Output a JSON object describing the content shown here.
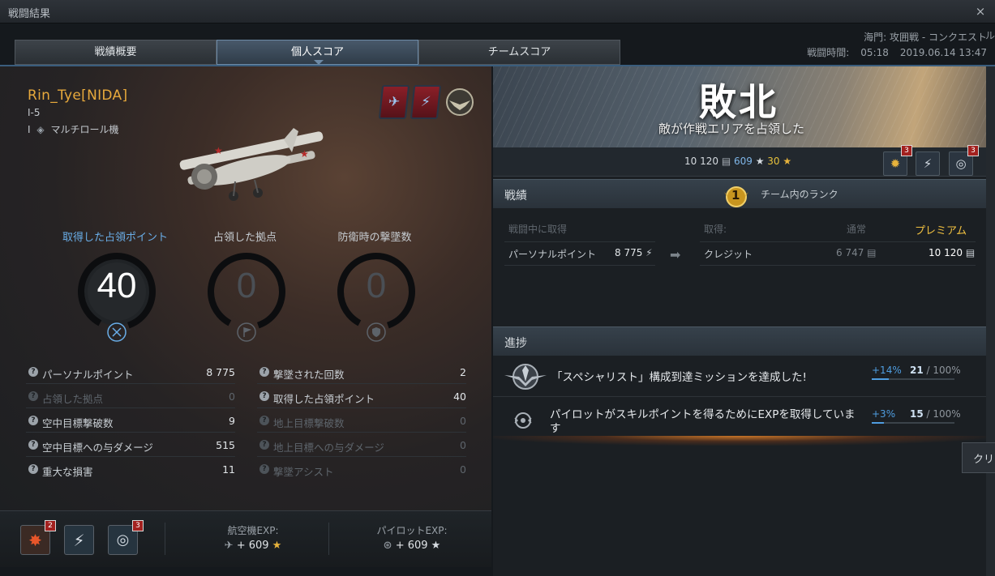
{
  "window": {
    "title": "戦闘結果",
    "close": "×"
  },
  "tabs": [
    {
      "label": "戦績概要"
    },
    {
      "label": "個人スコア"
    },
    {
      "label": "チームスコア"
    }
  ],
  "header": {
    "map_mode": "海門: 攻囲戦 - コンクエスト",
    "duration_label": "戦闘時間:",
    "duration": "05:18",
    "datetime": "2019.06.14 13:47",
    "edge_text": "ル"
  },
  "player": {
    "name": "Rin_Tye[NIDA]",
    "aircraft": "I-5",
    "tier": "I",
    "role": "マルチロール機"
  },
  "key_stats": [
    {
      "label": "取得した占領ポイント",
      "value": "40",
      "icon": "crossed-swords-icon",
      "active": true
    },
    {
      "label": "占領した拠点",
      "value": "0",
      "icon": "flag-icon",
      "active": false
    },
    {
      "label": "防衛時の撃墜数",
      "value": "0",
      "icon": "shield-icon",
      "active": false
    }
  ],
  "stats_left": [
    {
      "label": "パーソナルポイント",
      "value": "8 775",
      "dim": false
    },
    {
      "label": "占領した拠点",
      "value": "0",
      "dim": true
    },
    {
      "label": "空中目標撃破数",
      "value": "9",
      "dim": false
    },
    {
      "label": "空中目標への与ダメージ",
      "value": "515",
      "dim": false
    },
    {
      "label": "重大な損害",
      "value": "11",
      "dim": false
    }
  ],
  "stats_right": [
    {
      "label": "撃墜された回数",
      "value": "2",
      "dim": false
    },
    {
      "label": "取得した占領ポイント",
      "value": "40",
      "dim": false
    },
    {
      "label": "地上目標撃破数",
      "value": "0",
      "dim": true
    },
    {
      "label": "地上目標への与ダメージ",
      "value": "0",
      "dim": true
    },
    {
      "label": "撃墜アシスト",
      "value": "0",
      "dim": true
    }
  ],
  "bottom": {
    "badge_achievements": "2",
    "badge_medals": "3",
    "aircraft_exp_label": "航空機EXP:",
    "aircraft_exp": "+ 609",
    "pilot_exp_label": "パイロットEXP:",
    "pilot_exp": "+ 609"
  },
  "result": {
    "title": "敗北",
    "subtitle": "敵が作戦エリアを占領した",
    "credits": "10 120",
    "exp": "609",
    "free_exp": "30",
    "badge_1": "3",
    "badge_3": "3"
  },
  "earnings": {
    "section": "戦績",
    "rank_label": "チーム内のランク",
    "rank": "1",
    "earned_label": "戦闘中に取得",
    "personal_points_label": "パーソナルポイント",
    "personal_points": "8 775",
    "obtained_label": "取得:",
    "normal_label": "通常",
    "premium_label": "プレミアム",
    "credit_label": "クレジット",
    "credit_normal": "6 747",
    "credit_premium": "10 120"
  },
  "progress": {
    "section": "進捗",
    "items": [
      {
        "text": "「スペシャリスト」構成到達ミッションを達成した!",
        "delta": "+14%",
        "current": "21",
        "total": "/ 100%",
        "fraction": 0.21
      },
      {
        "text": "パイロットがスキルポイントを得るためにEXPを取得しています",
        "delta": "+3%",
        "current": "15",
        "total": "/ 100%",
        "fraction": 0.15
      }
    ]
  },
  "tooltip": "クリ",
  "colors": {
    "accent": "#e7a93c",
    "blue": "#6aaee8",
    "premium": "#f0c040"
  }
}
